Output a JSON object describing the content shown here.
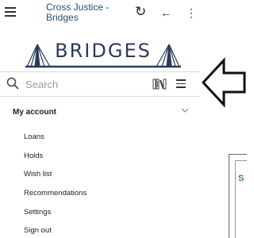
{
  "app": {
    "name": "Cross Justice - Bridges",
    "logo_text": "BRIDGES"
  },
  "toolbar": {
    "menu_icon": "hamburger-icon",
    "refresh_icon": "refresh-icon",
    "back_icon": "back-arrow-icon",
    "more_icon": "more-vert-icon"
  },
  "search": {
    "placeholder": "Search",
    "value": ""
  },
  "account": {
    "title": "My account",
    "items": [
      {
        "label": "Loans"
      },
      {
        "label": "Holds"
      },
      {
        "label": "Wish list"
      },
      {
        "label": "Recommendations"
      },
      {
        "label": "Settings"
      },
      {
        "label": "Sign out"
      }
    ]
  },
  "background": {
    "partial_letter": "S"
  },
  "colors": {
    "brand": "#1f4e79",
    "logo_navy": "#2b3a5c",
    "accent_green": "#3a8a3a"
  }
}
